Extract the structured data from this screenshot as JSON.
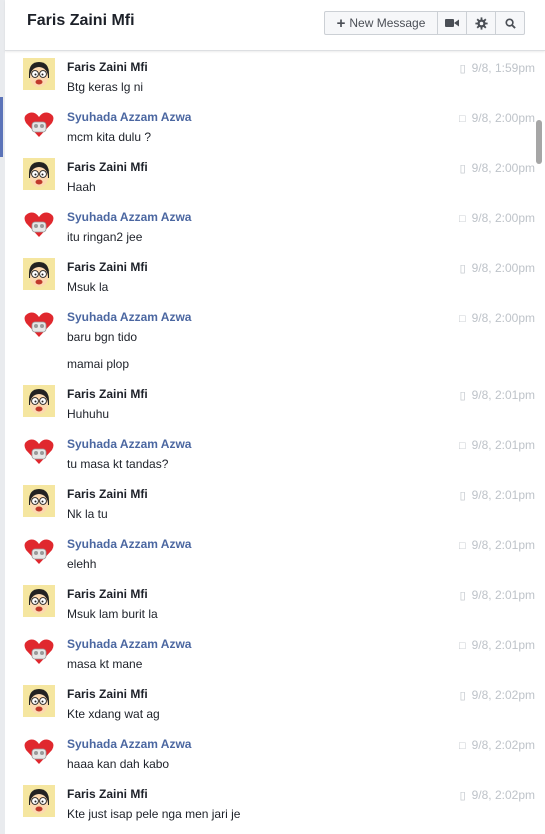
{
  "header": {
    "title": "Faris Zaini Mfi",
    "new_message_label": "New Message"
  },
  "icons": {
    "plus": "plus-icon",
    "video": "video-camera-icon",
    "settings": "gear-icon",
    "search": "search-icon",
    "mobile": "mobile-phone-icon",
    "chat": "chat-bubble-icon"
  },
  "colors": {
    "sender_self": "#1d2129",
    "sender_other": "#4b67a1",
    "timestamp": "#bec3c9"
  },
  "messages": [
    {
      "sender": "Faris Zaini Mfi",
      "type": "self",
      "time": "9/8, 1:59pm",
      "lines": [
        "Btg keras lg ni"
      ]
    },
    {
      "sender": "Syuhada Azzam Azwa",
      "type": "other",
      "time": "9/8, 2:00pm",
      "lines": [
        "mcm kita dulu ?"
      ]
    },
    {
      "sender": "Faris Zaini Mfi",
      "type": "self",
      "time": "9/8, 2:00pm",
      "lines": [
        "Haah"
      ]
    },
    {
      "sender": "Syuhada Azzam Azwa",
      "type": "other",
      "time": "9/8, 2:00pm",
      "lines": [
        "itu ringan2 jee"
      ]
    },
    {
      "sender": "Faris Zaini Mfi",
      "type": "self",
      "time": "9/8, 2:00pm",
      "lines": [
        "Msuk la"
      ]
    },
    {
      "sender": "Syuhada Azzam Azwa",
      "type": "other",
      "time": "9/8, 2:00pm",
      "lines": [
        "baru bgn tido",
        "mamai plop"
      ]
    },
    {
      "sender": "Faris Zaini Mfi",
      "type": "self",
      "time": "9/8, 2:01pm",
      "lines": [
        "Huhuhu"
      ]
    },
    {
      "sender": "Syuhada Azzam Azwa",
      "type": "other",
      "time": "9/8, 2:01pm",
      "lines": [
        "tu masa kt tandas?"
      ]
    },
    {
      "sender": "Faris Zaini Mfi",
      "type": "self",
      "time": "9/8, 2:01pm",
      "lines": [
        "Nk la tu"
      ]
    },
    {
      "sender": "Syuhada Azzam Azwa",
      "type": "other",
      "time": "9/8, 2:01pm",
      "lines": [
        "elehh"
      ]
    },
    {
      "sender": "Faris Zaini Mfi",
      "type": "self",
      "time": "9/8, 2:01pm",
      "lines": [
        "Msuk lam burit la"
      ]
    },
    {
      "sender": "Syuhada Azzam Azwa",
      "type": "other",
      "time": "9/8, 2:01pm",
      "lines": [
        "masa kt mane"
      ]
    },
    {
      "sender": "Faris Zaini Mfi",
      "type": "self",
      "time": "9/8, 2:02pm",
      "lines": [
        "Kte xdang wat ag"
      ]
    },
    {
      "sender": "Syuhada Azzam Azwa",
      "type": "other",
      "time": "9/8, 2:02pm",
      "lines": [
        "haaa kan dah kabo"
      ]
    },
    {
      "sender": "Faris Zaini Mfi",
      "type": "self",
      "time": "9/8, 2:02pm",
      "lines": [
        "Kte just isap pele nga men jari je"
      ]
    }
  ]
}
